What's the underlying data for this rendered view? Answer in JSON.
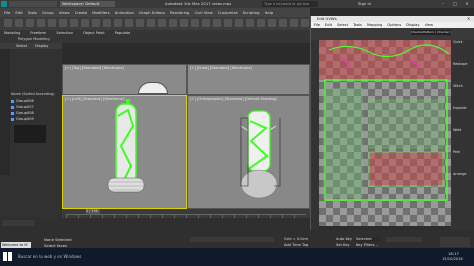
{
  "title_bar": {
    "workspace": "Workspace: Default",
    "app_title": "Autodesk 3ds Max 2017    vidas.max",
    "search_placeholder": "Type a keyword or phrase",
    "signin": "Sign In"
  },
  "menu": [
    "File",
    "Edit",
    "Tools",
    "Group",
    "Views",
    "Create",
    "Modifiers",
    "Animation",
    "Graph Editors",
    "Rendering",
    "Civil View",
    "Customize",
    "Scripting",
    "Help"
  ],
  "ribbon": {
    "tabs": [
      "Modeling",
      "Freeform",
      "Selection",
      "Object Paint",
      "Populate"
    ],
    "sub": "Polygon Modeling"
  },
  "scene_explorer": {
    "tabs": [
      "Select",
      "Display"
    ],
    "header": "Name (Sorted Ascending)",
    "items": [
      "Group006",
      "Group007",
      "Group008",
      "Group009"
    ]
  },
  "viewports": {
    "top_label": "[+] [Top] [Standard] [Wireframe]",
    "front_label": "[+] [Front] [Standard] [Wireframe]",
    "left_label": "[+] [Left] [Standard] [Wireframe]",
    "persp_label": "[+] [Orthographic] [Standard] [Default Shading]"
  },
  "timeline": {
    "frame": "0 / 100"
  },
  "status": {
    "selection": "None Selected",
    "prompt": "Select faces",
    "welcome": "Welcome to M",
    "grid": "Grid = 0.0cm",
    "addtime": "Add Time Tag",
    "autokey": "Auto Key",
    "setkey": "Set Key",
    "selected": "Selected",
    "filters": "Key Filters..."
  },
  "uvw": {
    "title": "Edit UVWs",
    "menu": [
      "File",
      "Edit",
      "Select",
      "Tools",
      "Mapping",
      "Options",
      "Display",
      "View"
    ],
    "checker": "CheckerPattern  ( Checker )",
    "right_labels": [
      "Quick",
      "Reshape",
      "Stitch",
      "Explode",
      "Weld",
      "Peel",
      "Arrange"
    ]
  },
  "taskbar": {
    "search_placeholder": "Buscar en la web y en Windows",
    "time": "18:17",
    "date": "15/10/2016"
  },
  "colors": {
    "accent": "#d9d400",
    "uv_green": "#4cff2f",
    "checker_red": "#c84545"
  }
}
